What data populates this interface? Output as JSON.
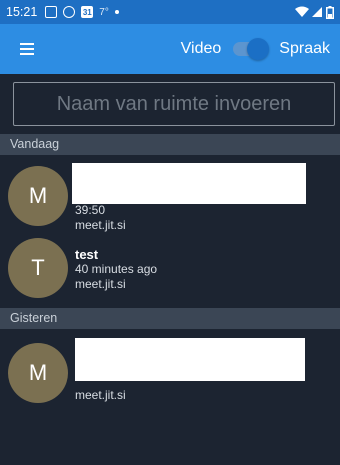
{
  "status_bar": {
    "time": "15:21",
    "temp_indicator": "7°",
    "icons": [
      "gallery-icon",
      "chat-bubble-icon",
      "calendar-icon",
      "wifi-icon",
      "signal-icon",
      "battery-icon"
    ],
    "calendar_day": "31"
  },
  "app_bar": {
    "menu_icon": "hamburger-menu-icon",
    "video_label": "Video",
    "audio_label": "Spraak",
    "audio_mode_on": true
  },
  "room_input": {
    "placeholder": "Naam van ruimte invoeren",
    "value": ""
  },
  "sections": [
    {
      "label": "Vandaag"
    },
    {
      "label": "Gisteren"
    }
  ],
  "recent_rooms": [
    {
      "avatar_letter": "M",
      "title": "",
      "duration": "39:50",
      "server": "meet.jit.si"
    },
    {
      "avatar_letter": "T",
      "title": "test",
      "duration": "40 minutes ago",
      "server": "meet.jit.si"
    },
    {
      "avatar_letter": "M",
      "title": "",
      "duration": "",
      "server": "meet.jit.si"
    }
  ],
  "colors": {
    "status_bar": "#1e6fc3",
    "app_bar": "#2d8de3",
    "background": "#1c2431",
    "section_header": "#3b4655",
    "avatar": "#7b7051"
  }
}
